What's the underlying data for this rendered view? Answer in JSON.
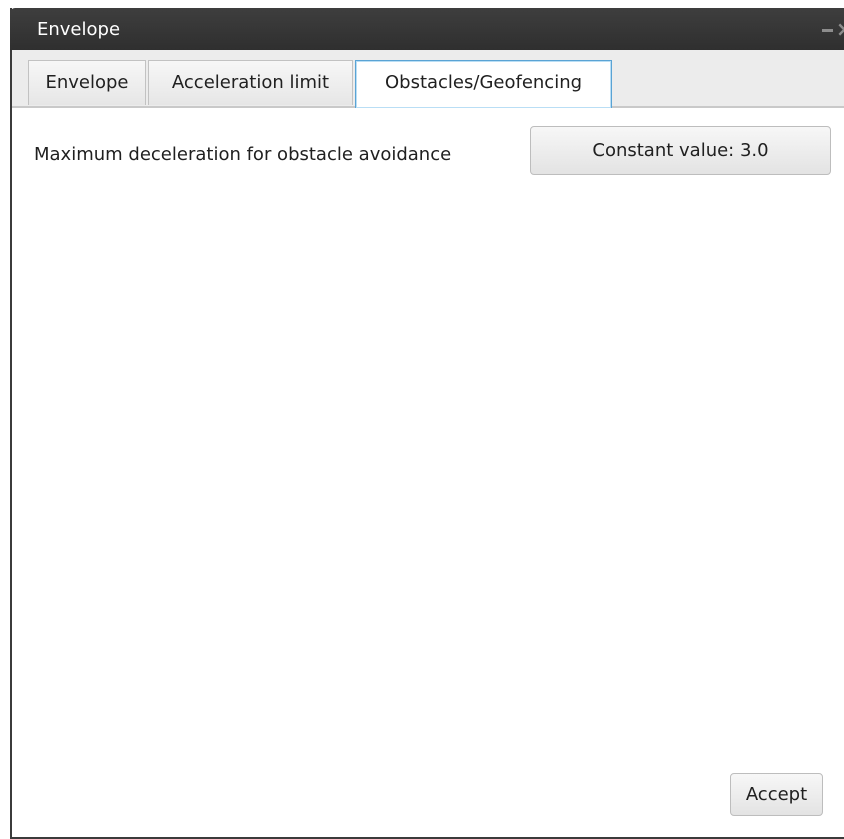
{
  "window": {
    "title": "Envelope"
  },
  "tabs": [
    {
      "label": "Envelope",
      "active": false
    },
    {
      "label": "Acceleration limit",
      "active": false
    },
    {
      "label": "Obstacles/Geofencing",
      "active": true
    }
  ],
  "obstacles": {
    "max_deceleration_label": "Maximum deceleration for obstacle avoidance",
    "max_deceleration_value": "Constant value: 3.0"
  },
  "footer": {
    "accept_label": "Accept"
  },
  "icons": {
    "minimize": "minimize-icon",
    "close": "close-icon"
  },
  "colors": {
    "titlebar": "#3a3a3a",
    "active_tab_border": "#5aa3d4",
    "window_border": "#3b3b3b"
  }
}
